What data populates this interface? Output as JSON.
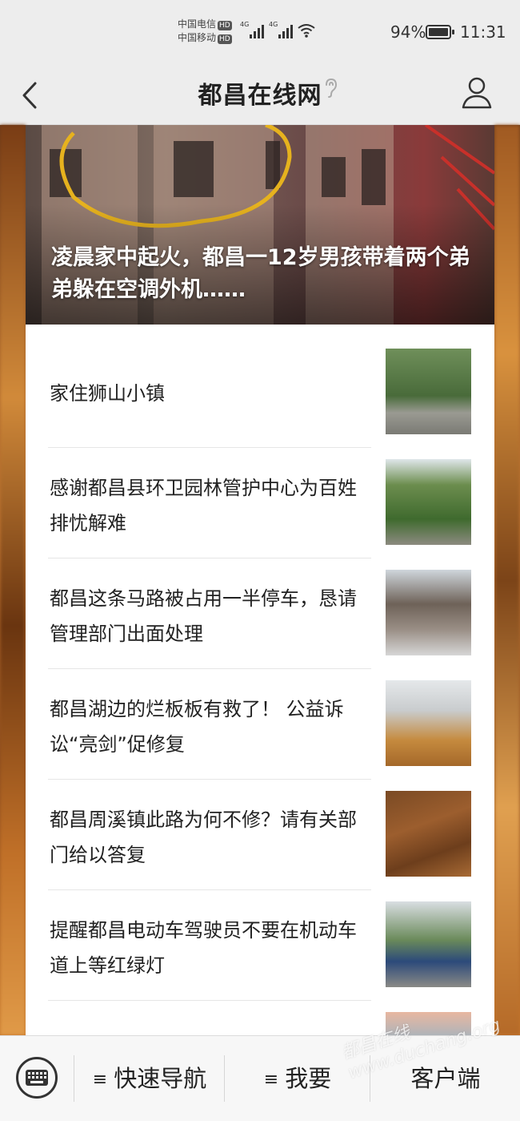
{
  "status_bar": {
    "carrier_1": "中国电信",
    "carrier_2": "中国移动",
    "hd_label": "HD",
    "network_label": "4G",
    "battery": "94%",
    "time": "11:31"
  },
  "header": {
    "title": "都昌在线网"
  },
  "hero": {
    "title": "凌晨家中起火，都昌一12岁男孩带着两个弟弟躲在空调外机……"
  },
  "news": [
    {
      "title": "家住狮山小镇"
    },
    {
      "title": "感谢都昌县环卫园林管护中心为百姓排忧解难"
    },
    {
      "title": "都昌这条马路被占用一半停车，恳请管理部门出面处理"
    },
    {
      "title": "都昌湖边的烂板板有救了！ 公益诉讼“亮剑”促修复"
    },
    {
      "title": "都昌周溪镇此路为何不修？请有关部门给以答复"
    },
    {
      "title": "提醒都昌电动车驾驶员不要在机动车道上等红绿灯"
    },
    {
      "title": ""
    }
  ],
  "bottom_bar": {
    "quick_nav": "快速导航",
    "want": "我要",
    "client": "客户端",
    "menu_glyph": "≡"
  },
  "watermark": "都昌在线 www.duchang.org"
}
